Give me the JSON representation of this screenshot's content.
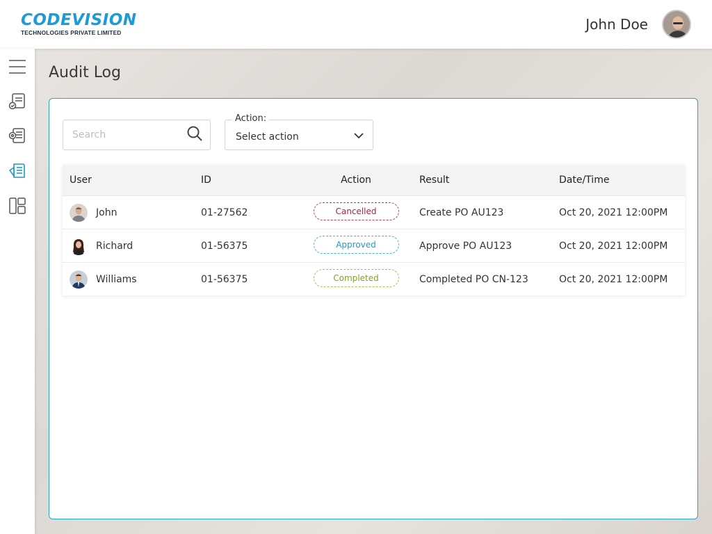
{
  "header": {
    "logo_main": "CODEVISION",
    "logo_sub": "TECHNOLOGIES PRIVATE LIMITED",
    "user_name": "John Doe"
  },
  "sidebar": {
    "items": [
      {
        "icon": "menu-icon"
      },
      {
        "icon": "document-check-icon"
      },
      {
        "icon": "document-list-icon"
      },
      {
        "icon": "audit-log-icon",
        "active": true
      },
      {
        "icon": "dashboard-icon"
      }
    ]
  },
  "page": {
    "title": "Audit Log"
  },
  "filters": {
    "search_placeholder": "Search",
    "action_label": "Action:",
    "action_value": "Select action"
  },
  "table": {
    "headers": {
      "user": "User",
      "id": "ID",
      "action": "Action",
      "result": "Result",
      "date": "Date/Time"
    },
    "rows": [
      {
        "user": "John",
        "id": "01-27562",
        "action": "Cancelled",
        "result": "Create PO AU123",
        "date": "Oct 20, 2021 12:00PM"
      },
      {
        "user": "Richard",
        "id": "01-56375",
        "action": "Approved",
        "result": "Approve PO AU123",
        "date": "Oct 20, 2021 12:00PM"
      },
      {
        "user": "Williams",
        "id": "01-56375",
        "action": "Completed",
        "result": "Completed PO CN-123",
        "date": "Oct 20, 2021 12:00PM"
      }
    ]
  },
  "colors": {
    "brand": "#1d9bd7",
    "card_border": "#2fa3c4",
    "cancelled": "#b0203f",
    "approved": "#1e9ac8",
    "completed": "#7aa61d"
  }
}
